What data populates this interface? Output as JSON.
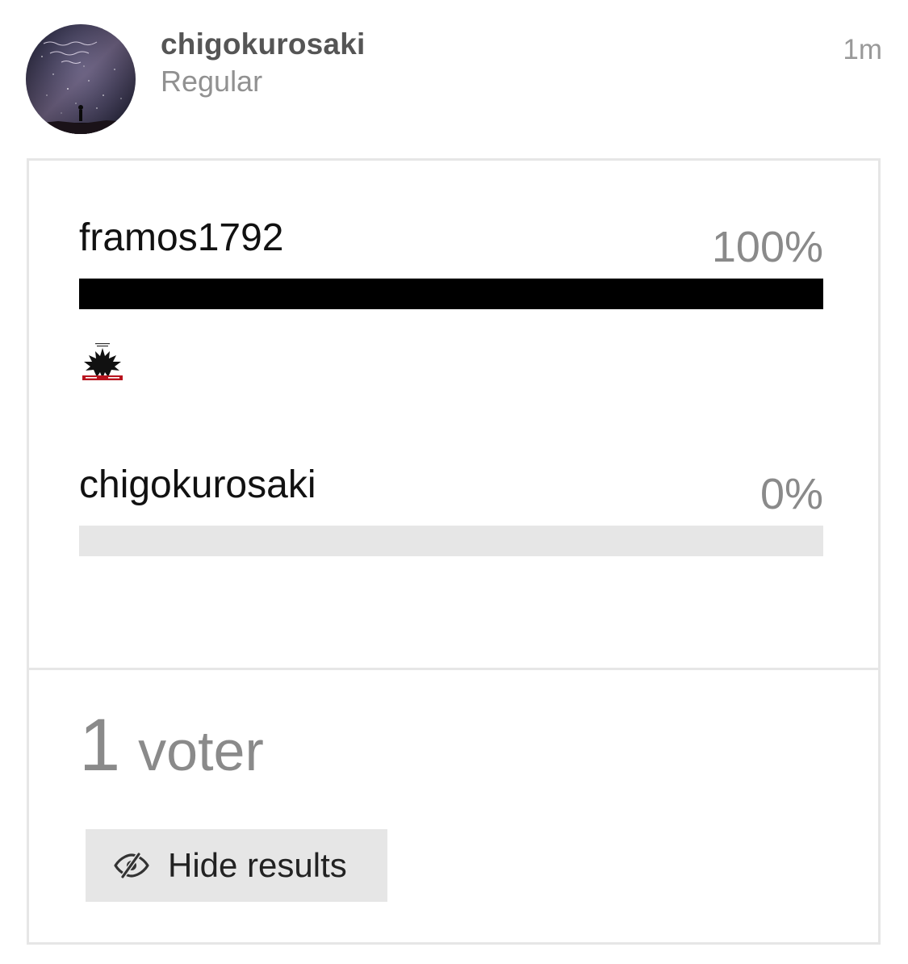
{
  "post": {
    "username": "chigokurosaki",
    "user_title": "Regular",
    "age": "1m",
    "avatar_icon": "night-sky-avatar-icon"
  },
  "poll": {
    "options": [
      {
        "name": "framos1792",
        "percent_label": "100%",
        "percent": 100
      },
      {
        "name": "chigokurosaki",
        "percent_label": "0%",
        "percent": 0
      }
    ],
    "voter_avatar_icon": "phoenix-avatar-icon",
    "voters": {
      "count": "1",
      "label": "voter"
    },
    "hide_button": {
      "label": "Hide results",
      "icon": "eye-slash-icon"
    },
    "colors": {
      "bar_fill": "#000000",
      "bar_track": "#e6e6e6",
      "border": "#e6e6e6",
      "muted_text": "#8a8a8a"
    }
  }
}
